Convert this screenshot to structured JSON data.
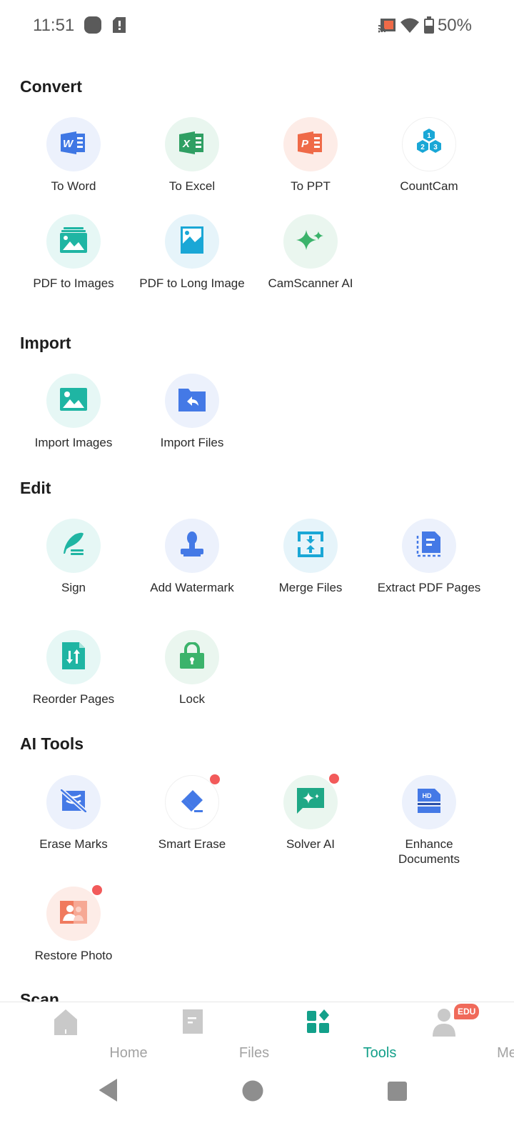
{
  "status_bar": {
    "time": "11:51",
    "battery": "50%",
    "icons": [
      "media-icon",
      "sim-alert-icon",
      "cast-icon",
      "wifi-icon",
      "battery-icon"
    ]
  },
  "sections": [
    {
      "title": "Convert",
      "items": [
        {
          "label": "To Word",
          "icon": "word-icon",
          "bg": "#ecf1fc",
          "badge": false
        },
        {
          "label": "To Excel",
          "icon": "excel-icon",
          "bg": "#e9f6ef",
          "badge": false
        },
        {
          "label": "To PPT",
          "icon": "ppt-icon",
          "bg": "#fdece7",
          "badge": false
        },
        {
          "label": "CountCam",
          "icon": "countcam-icon",
          "bg": "#ffffff",
          "badge": false
        },
        {
          "label": "PDF to Images",
          "icon": "pdf-to-images-icon",
          "bg": "#e6f7f5",
          "badge": false
        },
        {
          "label": "PDF to Long Image",
          "icon": "pdf-to-long-image-icon",
          "bg": "#e6f4fa",
          "badge": false
        },
        {
          "label": "CamScanner AI",
          "icon": "sparkle-icon",
          "bg": "#eaf6ef",
          "badge": false
        }
      ]
    },
    {
      "title": "Import",
      "items": [
        {
          "label": "Import Images",
          "icon": "image-icon",
          "bg": "#e6f7f5",
          "badge": false
        },
        {
          "label": "Import Files",
          "icon": "folder-import-icon",
          "bg": "#ecf1fc",
          "badge": false
        }
      ]
    },
    {
      "title": "Edit",
      "items": [
        {
          "label": "Sign",
          "icon": "quill-sign-icon",
          "bg": "#e6f7f5",
          "badge": false
        },
        {
          "label": "Add Watermark",
          "icon": "stamp-icon",
          "bg": "#ecf1fc",
          "badge": false
        },
        {
          "label": "Merge Files",
          "icon": "merge-icon",
          "bg": "#e6f4fa",
          "badge": false
        },
        {
          "label": "Extract PDF Pages",
          "icon": "extract-pages-icon",
          "bg": "#ecf1fc",
          "badge": false
        },
        {
          "label": "Reorder Pages",
          "icon": "reorder-icon",
          "bg": "#e6f7f5",
          "badge": false
        },
        {
          "label": "Lock",
          "icon": "lock-icon",
          "bg": "#eaf6ef",
          "badge": false
        }
      ]
    },
    {
      "title": "AI Tools",
      "items": [
        {
          "label": "Erase Marks",
          "icon": "erase-marks-icon",
          "bg": "#ecf1fc",
          "badge": false
        },
        {
          "label": "Smart Erase",
          "icon": "eraser-icon",
          "bg": "#ffffff",
          "badge": true
        },
        {
          "label": "Solver AI",
          "icon": "solver-chat-icon",
          "bg": "#eaf6ef",
          "badge": true
        },
        {
          "label": "Enhance Documents",
          "icon": "hd-enhance-icon",
          "bg": "#ecf1fc",
          "badge": false
        },
        {
          "label": "Restore Photo",
          "icon": "restore-photo-icon",
          "bg": "#fdece7",
          "badge": true
        }
      ]
    },
    {
      "title": "Scan",
      "items": []
    }
  ],
  "bottom_nav": {
    "items": [
      {
        "label": "Home",
        "icon": "home-icon",
        "active": false
      },
      {
        "label": "Files",
        "icon": "files-icon",
        "active": false
      },
      {
        "label": "Tools",
        "icon": "tools-icon",
        "active": true
      },
      {
        "label": "Me",
        "icon": "profile-icon",
        "active": false,
        "badge": "EDU"
      }
    ]
  },
  "colors": {
    "accent": "#13a08a",
    "badge_red": "#f25a5a",
    "word_blue": "#3f77e4",
    "excel_green": "#2f9f63",
    "ppt_orange": "#ef6a48",
    "teal": "#1fb5a3",
    "sky": "#1aa7d6",
    "green": "#3bb36b",
    "blue": "#4479e6",
    "coral": "#f07a5e"
  }
}
